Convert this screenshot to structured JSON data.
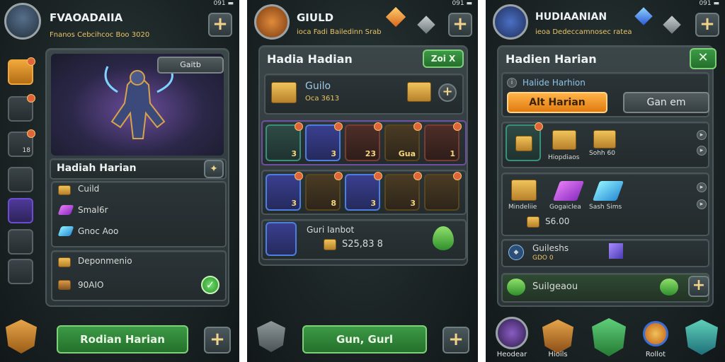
{
  "status": {
    "right": "091 ▬"
  },
  "panel1": {
    "header_title": "FVAOADAIIA",
    "header_sub": "Fnanos   Cebcihcoc  Boo 3020",
    "feature_button": "Gaitb",
    "hero_name": "Hadiah Harian",
    "items": [
      {
        "label": "Cuild"
      },
      {
        "label": "Smal6r"
      },
      {
        "label": "Gnoc Aoo"
      }
    ],
    "lower": [
      {
        "label": "Deponmenio"
      },
      {
        "label": "90AIO"
      }
    ],
    "action_button": "Rodian Harian",
    "side_counts": [
      "",
      "",
      "18",
      "",
      "",
      "",
      ""
    ]
  },
  "panel2": {
    "header_title": "GIULD",
    "header_sub": "ioca   Fadi Bailedinn  Srab",
    "card_title": "Hadia Hadian",
    "card_badge": "Zoi X",
    "guild_label": "Guilo",
    "guild_sub": "Oca 3613",
    "row1_counts": [
      "3",
      "3",
      "23",
      "Gua",
      "1"
    ],
    "row2_counts": [
      "3",
      "8",
      "3",
      "3",
      ""
    ],
    "reward_label": "Guri Ianbot",
    "reward_value": "S25,83 8",
    "action_button": "Gun, Gurl"
  },
  "panel3": {
    "header_title": "HUDIAANIAN",
    "header_sub": "ieoa   Dedeccamnosec  ratea",
    "card_title": "Hadien Harian",
    "tab_label": "Halide Harhion",
    "btn_orange": "Alt Harian",
    "btn_gray": "Gan em",
    "row1_labels": [
      "",
      "Hiopdiaos",
      "Sohh 60"
    ],
    "row2_labels": [
      "Mindeliie",
      "Gogaiclea",
      "Sash Sims"
    ],
    "row2_value": "S6.00",
    "info_label": "Guileshs",
    "info_sub": "GDO 0",
    "bonus_label": "Suilgeaou",
    "nav": [
      {
        "label": "Heodear"
      },
      {
        "label": "Hioils"
      },
      {
        "label": ""
      },
      {
        "label": "Rollot"
      },
      {
        "label": ""
      }
    ]
  }
}
